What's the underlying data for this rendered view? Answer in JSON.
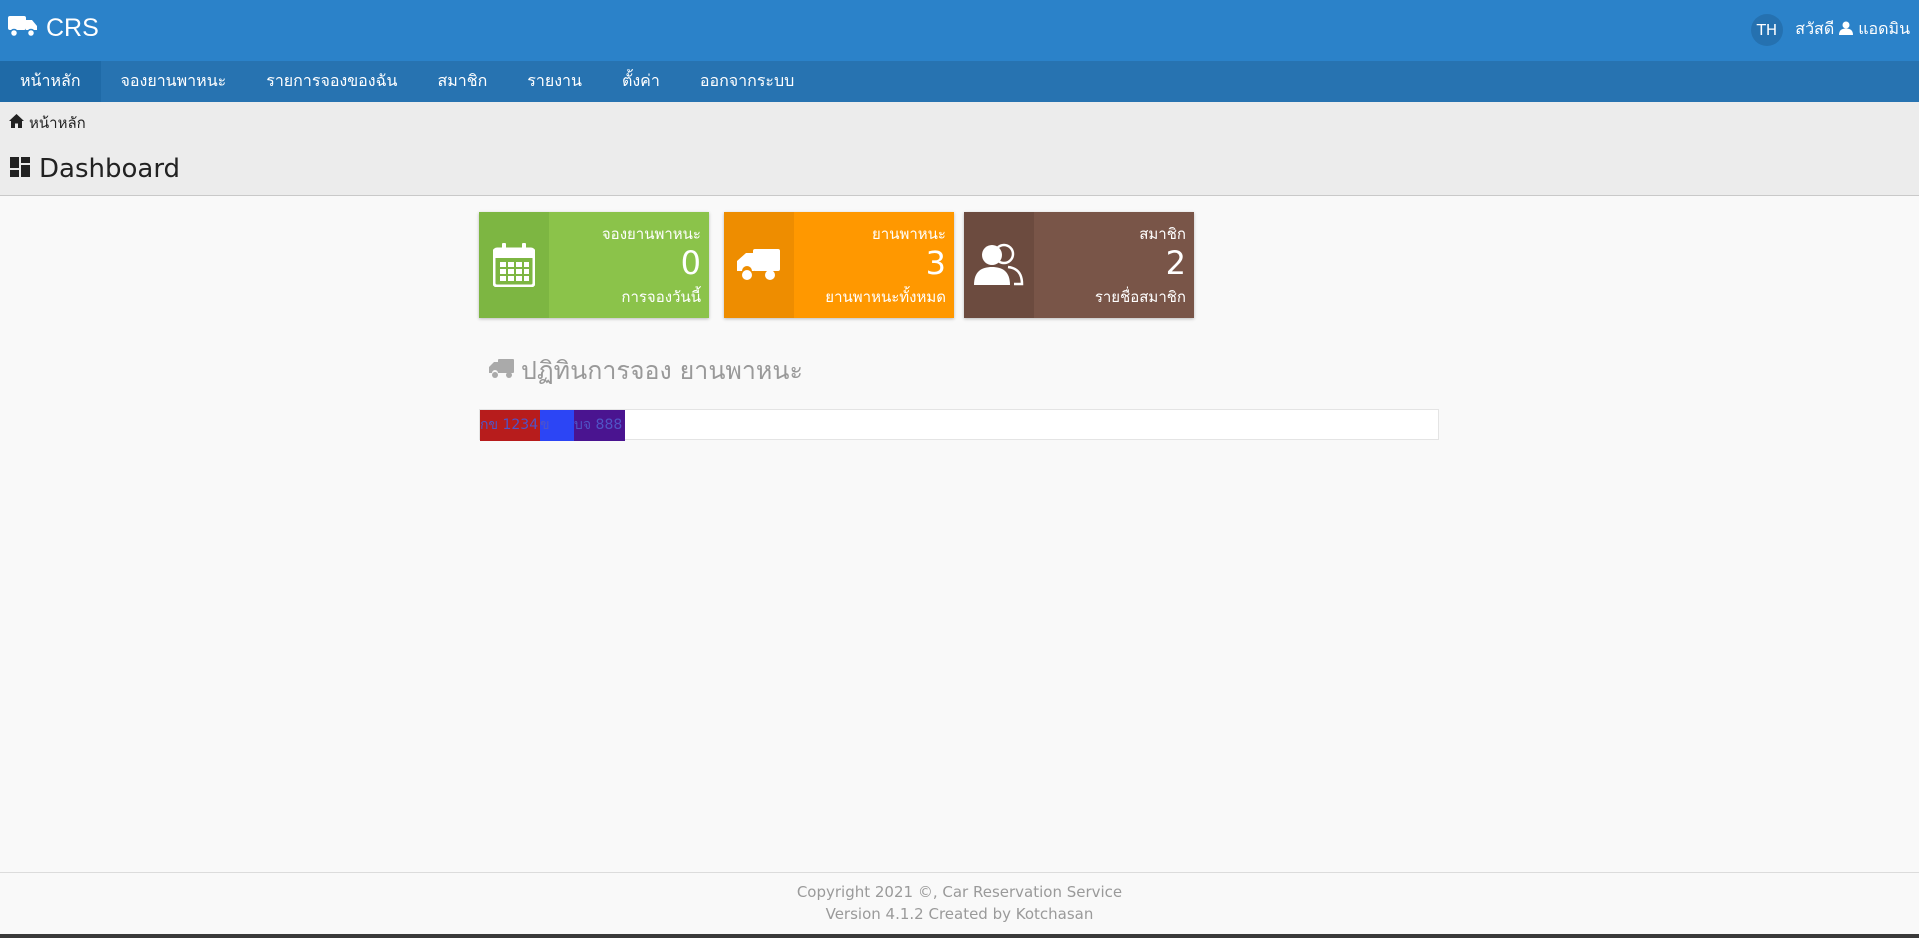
{
  "header": {
    "brand": "CRS",
    "language": "TH",
    "greeting": "สวัสดี",
    "username": "แอดมิน"
  },
  "nav": {
    "items": [
      {
        "label": "หน้าหลัก",
        "active": true
      },
      {
        "label": "จองยานพาหนะ"
      },
      {
        "label": "รายการจองของฉัน"
      },
      {
        "label": "สมาชิก"
      },
      {
        "label": "รายงาน"
      },
      {
        "label": "ตั้งค่า"
      },
      {
        "label": "ออกจากระบบ"
      }
    ]
  },
  "breadcrumb": {
    "home": "หน้าหลัก"
  },
  "page": {
    "title": "Dashboard"
  },
  "cards": [
    {
      "title": "จองยานพาหนะ",
      "value": "0",
      "subtitle": "การจองวันนี้",
      "color": "#8bc34a",
      "icon": "calendar-icon"
    },
    {
      "title": "ยานพาหนะ",
      "value": "3",
      "subtitle": "ยานพาหนะทั้งหมด",
      "color": "#ff9800",
      "icon": "truck-icon"
    },
    {
      "title": "สมาชิก",
      "value": "2",
      "subtitle": "รายชื่อสมาชิก",
      "color": "#795548",
      "icon": "users-icon"
    }
  ],
  "calendar": {
    "heading": "ปฏิทินการจอง ยานพาหนะ",
    "events": [
      {
        "label": "กข 1234",
        "color": "#b71c1c"
      },
      {
        "label": "ข",
        "color": "#2c45f5"
      },
      {
        "label": "บจ 888",
        "color": "#4a1490"
      }
    ]
  },
  "footer": {
    "line1": "Copyright 2021 ©, Car Reservation Service",
    "line2": "Version 4.1.2 Created by Kotchasan"
  }
}
